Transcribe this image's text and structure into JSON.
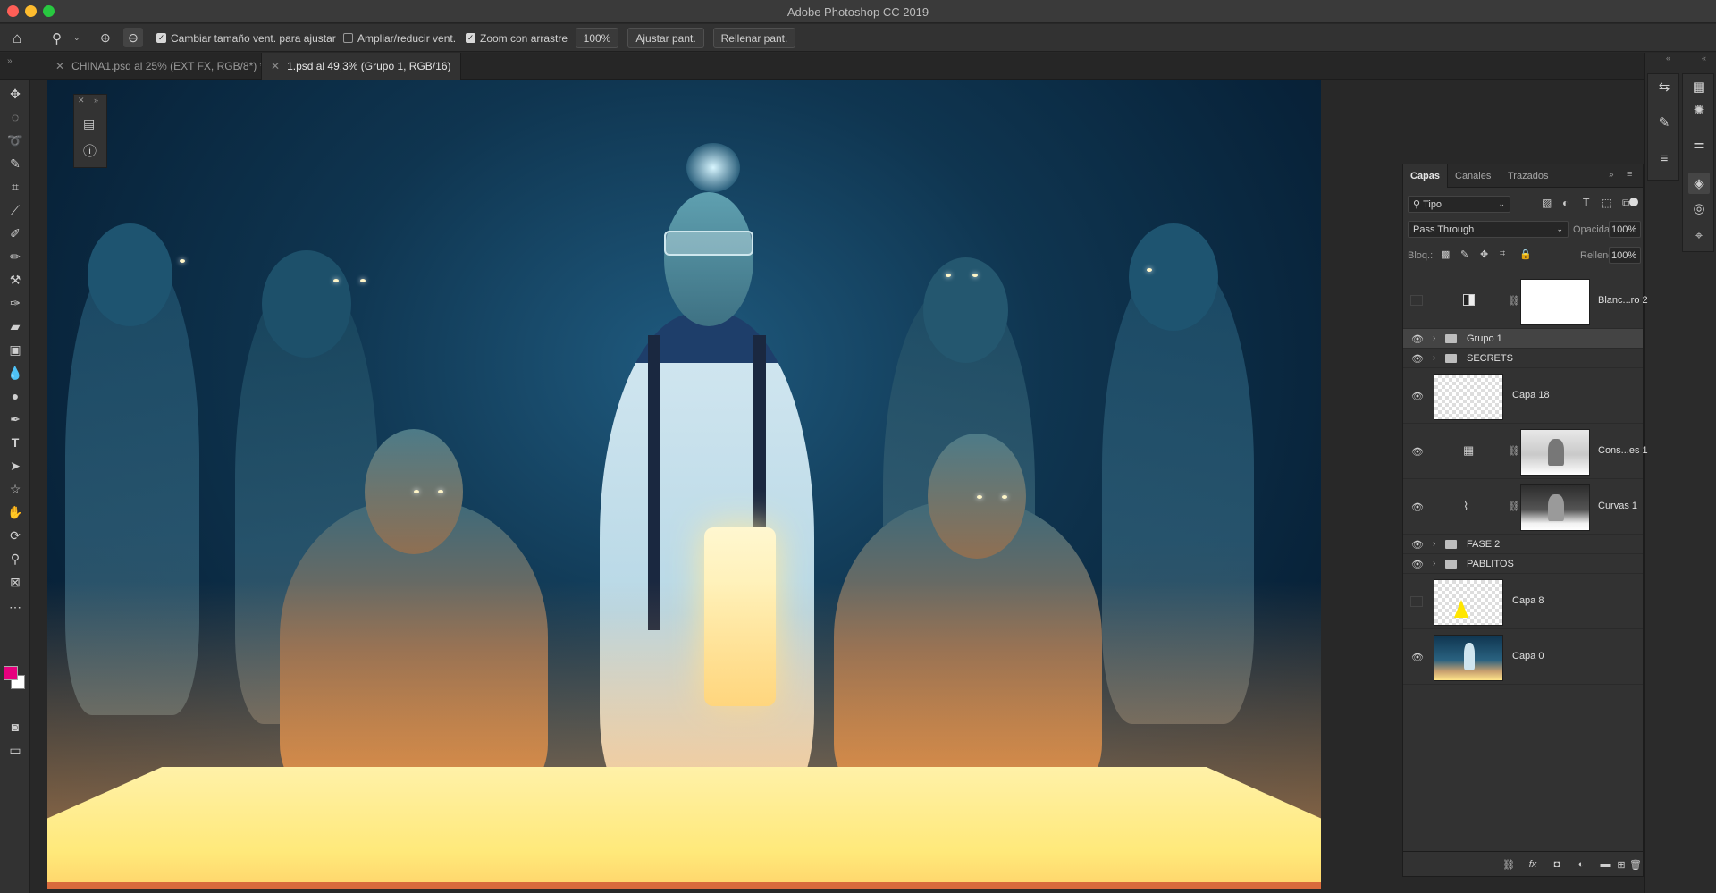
{
  "window": {
    "title": "Adobe Photoshop CC 2019"
  },
  "options_bar": {
    "resize_windows_label": "Cambiar tamaño vent. para ajustar",
    "resize_windows_checked": true,
    "zoom_all_label": "Ampliar/reducir vent.",
    "zoom_all_checked": false,
    "scrubby_zoom_label": "Zoom con arrastre",
    "scrubby_zoom_checked": true,
    "zoom_value": "100%",
    "fit_screen_label": "Ajustar pant.",
    "fill_screen_label": "Rellenar pant."
  },
  "tabs": [
    {
      "label": "CHINA1.psd al 25% (EXT FX, RGB/8*) *",
      "active": false
    },
    {
      "label": "1.psd al 49,3% (Grupo 1, RGB/16)",
      "active": true
    }
  ],
  "tools": [
    "move-tool",
    "marquee-tool",
    "lasso-tool",
    "quick-select-tool",
    "crop-tool",
    "eyedropper-tool",
    "healing-brush-tool",
    "brush-tool",
    "clone-stamp-tool",
    "history-brush-tool",
    "eraser-tool",
    "gradient-tool",
    "blur-tool",
    "dodge-tool",
    "pen-tool",
    "type-tool",
    "path-select-tool",
    "shape-tool",
    "hand-tool",
    "rotate-view-tool",
    "zoom-tool",
    "frame-tool",
    "more-tools"
  ],
  "colors": {
    "foreground": "#e6007e",
    "background": "#ffffff",
    "accent_selected": "#444444"
  },
  "layers_panel": {
    "tabs": [
      "Capas",
      "Canales",
      "Trazados"
    ],
    "filter_label": "Tipo",
    "blend_mode": "Pass Through",
    "opacity_label": "Opacidad:",
    "opacity_value": "100%",
    "lock_label": "Bloq.:",
    "fill_label": "Relleno:",
    "fill_value": "100%",
    "layers": [
      {
        "name": "Blanc...ro 2",
        "kind": "adjustment",
        "visible": false,
        "thumb": "white"
      },
      {
        "name": "Grupo 1",
        "kind": "group",
        "visible": true,
        "selected": true
      },
      {
        "name": "SECRETS",
        "kind": "group",
        "visible": true
      },
      {
        "name": "Capa 18",
        "kind": "pixel",
        "visible": true,
        "thumb": "checker"
      },
      {
        "name": "Cons...es 1",
        "kind": "adjustment",
        "visible": true,
        "thumb": "scene-light"
      },
      {
        "name": "Curvas 1",
        "kind": "adjustment",
        "visible": true,
        "thumb": "scene-dark"
      },
      {
        "name": "FASE 2",
        "kind": "group",
        "visible": true
      },
      {
        "name": "PABLITOS",
        "kind": "group",
        "visible": true
      },
      {
        "name": "Capa 8",
        "kind": "pixel",
        "visible": false,
        "thumb": "checker-yellow"
      },
      {
        "name": "Capa 0",
        "kind": "pixel",
        "visible": true,
        "thumb": "scene"
      }
    ]
  }
}
